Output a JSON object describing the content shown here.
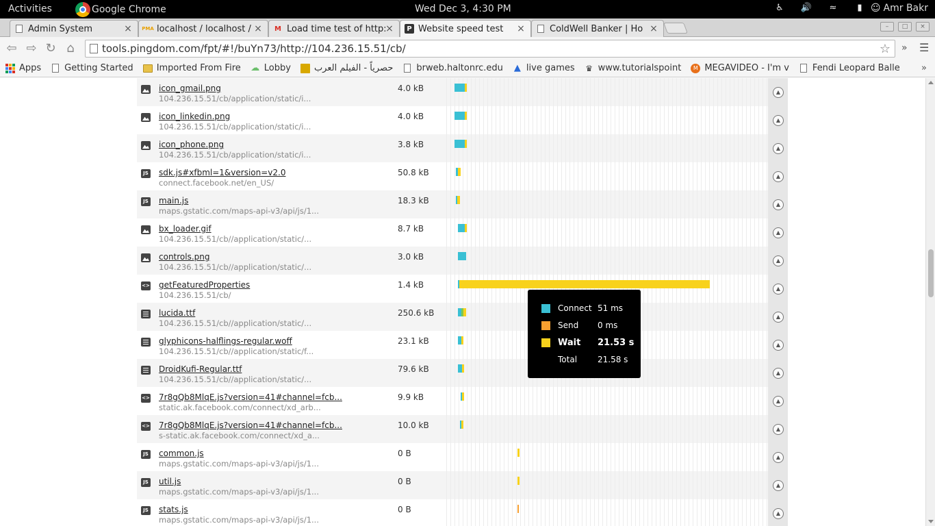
{
  "topbar": {
    "activities": "Activities",
    "app_name": "Google Chrome",
    "clock": "Wed Dec  3,  4:30 PM",
    "user": "Amr Bakr"
  },
  "tabs": [
    {
      "title": "Admin System",
      "favicon": "doc-icon"
    },
    {
      "title": "localhost / localhost /",
      "favicon": "phpmyadmin-icon",
      "fav_text": "PMA"
    },
    {
      "title": "Load time test of http:",
      "favicon": "gmail-icon",
      "fav_text": "M"
    },
    {
      "title": "Website speed test",
      "favicon": "pingdom-icon",
      "fav_text": "P"
    },
    {
      "title": "ColdWell Banker | Ho",
      "favicon": "doc-icon"
    }
  ],
  "omnibox": {
    "url": "tools.pingdom.com/fpt/#!/buYn73/http://104.236.15.51/cb/"
  },
  "bookmarks": [
    {
      "label": "Apps",
      "icon": "apps-icon"
    },
    {
      "label": "Getting Started",
      "icon": "doc-icon"
    },
    {
      "label": "Imported From Fire",
      "icon": "folder-icon"
    },
    {
      "label": "Lobby",
      "icon": "cloud-icon"
    },
    {
      "label": "حصرياً - الفيلم العرب",
      "icon": "film-icon"
    },
    {
      "label": "brweb.haltonrc.edu",
      "icon": "doc-icon"
    },
    {
      "label": "live games",
      "icon": "games-icon"
    },
    {
      "label": "www.tutorialspoint",
      "icon": "tutorials-icon"
    },
    {
      "label": "MEGAVIDEO - I'm v",
      "icon": "megavideo-icon"
    },
    {
      "label": "Fendi Leopard Balle",
      "icon": "doc-icon"
    }
  ],
  "rows": [
    {
      "name": "icon_gmail.png",
      "url": "104.236.15.51/cb/application/static/i...",
      "size": "4.0 kB",
      "type": "image",
      "bars": [
        {
          "start": 12,
          "w": 15,
          "c": "#3ac0d4"
        },
        {
          "start": 27,
          "w": 3,
          "c": "#f8d21c"
        }
      ]
    },
    {
      "name": "icon_linkedin.png",
      "url": "104.236.15.51/cb/application/static/i...",
      "size": "4.0 kB",
      "type": "image",
      "bars": [
        {
          "start": 12,
          "w": 15,
          "c": "#3ac0d4"
        },
        {
          "start": 27,
          "w": 3,
          "c": "#f8d21c"
        }
      ]
    },
    {
      "name": "icon_phone.png",
      "url": "104.236.15.51/cb/application/static/i...",
      "size": "3.8 kB",
      "type": "image",
      "bars": [
        {
          "start": 12,
          "w": 15,
          "c": "#3ac0d4"
        },
        {
          "start": 27,
          "w": 3,
          "c": "#f8d21c"
        }
      ]
    },
    {
      "name": "sdk.js#xfbml=1&version=v2.0",
      "url": "connect.facebook.net/en_US/",
      "size": "50.8 kB",
      "type": "js",
      "bars": [
        {
          "start": 14,
          "w": 3,
          "c": "#3ac0d4"
        },
        {
          "start": 17,
          "w": 4,
          "c": "#f8d21c"
        }
      ]
    },
    {
      "name": "main.js",
      "url": "maps.gstatic.com/maps-api-v3/api/js/1...",
      "size": "18.3 kB",
      "type": "js",
      "bars": [
        {
          "start": 14,
          "w": 2,
          "c": "#3ac0d4"
        },
        {
          "start": 16,
          "w": 4,
          "c": "#f8d21c"
        }
      ]
    },
    {
      "name": "bx_loader.gif",
      "url": "104.236.15.51/cb//application/static/...",
      "size": "8.7 kB",
      "type": "image",
      "bars": [
        {
          "start": 17,
          "w": 10,
          "c": "#3ac0d4"
        },
        {
          "start": 27,
          "w": 3,
          "c": "#f8d21c"
        }
      ]
    },
    {
      "name": "controls.png",
      "url": "104.236.15.51/cb//application/static/...",
      "size": "3.0 kB",
      "type": "image",
      "bars": [
        {
          "start": 17,
          "w": 12,
          "c": "#3ac0d4"
        }
      ]
    },
    {
      "name": "getFeaturedProperties",
      "url": "104.236.15.51/cb/",
      "size": "1.4 kB",
      "type": "code",
      "bars": [
        {
          "start": 17,
          "w": 2,
          "c": "#3ac0d4"
        },
        {
          "start": 19,
          "w": 366,
          "c": "#f8d21c"
        }
      ]
    },
    {
      "name": "lucida.ttf",
      "url": "104.236.15.51/cb//application/static/...",
      "size": "250.6 kB",
      "type": "doc",
      "bars": [
        {
          "start": 17,
          "w": 5,
          "c": "#3ac0d4"
        },
        {
          "start": 22,
          "w": 3,
          "c": "#7ec850"
        },
        {
          "start": 25,
          "w": 4,
          "c": "#f8d21c"
        }
      ]
    },
    {
      "name": "glyphicons-halflings-regular.woff",
      "url": "104.236.15.51/cb//application/static/f...",
      "size": "23.1 kB",
      "type": "doc",
      "bars": [
        {
          "start": 17,
          "w": 5,
          "c": "#3ac0d4"
        },
        {
          "start": 22,
          "w": 3,
          "c": "#f8d21c"
        }
      ]
    },
    {
      "name": "DroidKufi-Regular.ttf",
      "url": "104.236.15.51/cb//application/static/...",
      "size": "79.6 kB",
      "type": "doc",
      "bars": [
        {
          "start": 17,
          "w": 6,
          "c": "#3ac0d4"
        },
        {
          "start": 23,
          "w": 3,
          "c": "#f8d21c"
        }
      ]
    },
    {
      "name": "7r8gQb8MlqE.js?version=41#channel=fcb...",
      "url": "static.ak.facebook.com/connect/xd_arb...",
      "size": "9.9 kB",
      "type": "code",
      "bars": [
        {
          "start": 21,
          "w": 2,
          "c": "#3ac0d4"
        },
        {
          "start": 23,
          "w": 3,
          "c": "#f8d21c"
        }
      ]
    },
    {
      "name": "7r8gQb8MlqE.js?version=41#channel=fcb...",
      "url": "s-static.ak.facebook.com/connect/xd_a...",
      "size": "10.0 kB",
      "type": "code",
      "bars": [
        {
          "start": 20,
          "w": 2,
          "c": "#3ac0d4"
        },
        {
          "start": 22,
          "w": 3,
          "c": "#f8d21c"
        }
      ]
    },
    {
      "name": "common.js",
      "url": "maps.gstatic.com/maps-api-v3/api/js/1...",
      "size": "0 B",
      "type": "js",
      "bars": [
        {
          "start": 104,
          "w": 3,
          "c": "#f8d21c"
        }
      ]
    },
    {
      "name": "util.js",
      "url": "maps.gstatic.com/maps-api-v3/api/js/1...",
      "size": "0 B",
      "type": "js",
      "bars": [
        {
          "start": 104,
          "w": 3,
          "c": "#f8d21c"
        }
      ]
    },
    {
      "name": "stats.js",
      "url": "maps.gstatic.com/maps-api-v3/api/js/1...",
      "size": "0 B",
      "type": "js",
      "bars": [
        {
          "start": 104,
          "w": 2,
          "c": "#f8a030"
        }
      ]
    }
  ],
  "tooltip": {
    "items": [
      {
        "label": "Connect",
        "value": "51 ms",
        "color": "#3ac0d4",
        "bold": false
      },
      {
        "label": "Send",
        "value": "0 ms",
        "color": "#f8a030",
        "bold": false
      },
      {
        "label": "Wait",
        "value": "21.53 s",
        "color": "#f8d21c",
        "bold": true
      },
      {
        "label": "Total",
        "value": "21.58 s",
        "color": "",
        "bold": false
      }
    ]
  }
}
